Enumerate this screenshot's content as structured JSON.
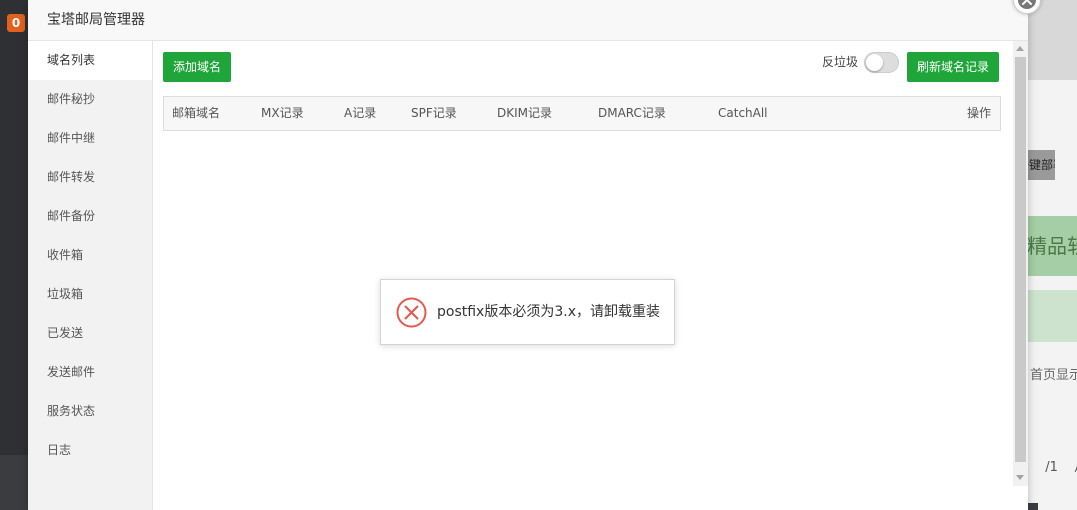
{
  "background": {
    "badge": "0",
    "right_button": "一键部署",
    "right_green": "精品软件推荐",
    "right_text": "首页显示",
    "pagination": [
      "1",
      "/1",
      "从"
    ]
  },
  "dialog": {
    "title": "宝塔邮局管理器",
    "menu": [
      {
        "label": "域名列表",
        "active": true
      },
      {
        "label": "邮件秘抄"
      },
      {
        "label": "邮件中继"
      },
      {
        "label": "邮件转发"
      },
      {
        "label": "邮件备份"
      },
      {
        "label": "收件箱"
      },
      {
        "label": "垃圾箱"
      },
      {
        "label": "已发送"
      },
      {
        "label": "发送邮件"
      },
      {
        "label": "服务状态"
      },
      {
        "label": "日志"
      }
    ],
    "toolbar": {
      "add_label": "添加域名",
      "spam_label": "反垃圾",
      "spam_enabled": false,
      "refresh_label": "刷新域名记录"
    },
    "table": {
      "headers": [
        "邮箱域名",
        "MX记录",
        "A记录",
        "SPF记录",
        "DKIM记录",
        "DMARC记录",
        "CatchAll",
        "操作"
      ]
    }
  },
  "message": {
    "text": "postfix版本必须为3.x，请卸载重装",
    "icon": "error-icon",
    "color": "#e45a4f"
  },
  "colors": {
    "accent": "#20a53a",
    "badge": "#e2611e"
  }
}
